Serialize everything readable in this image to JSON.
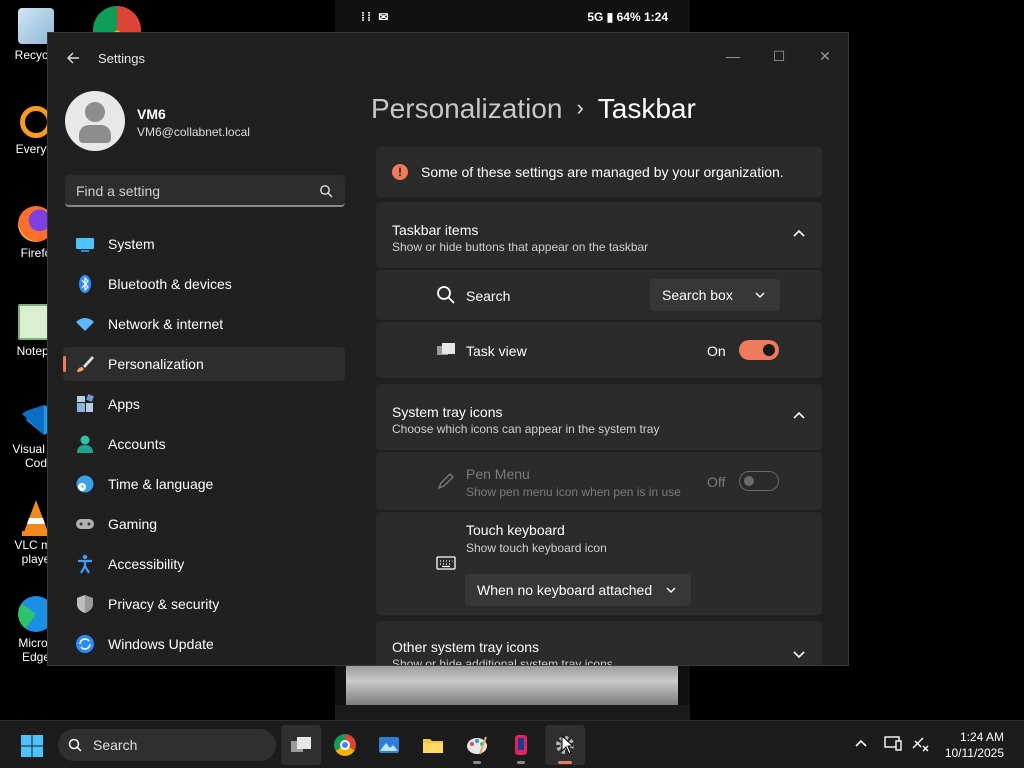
{
  "desktop": {
    "icons": [
      {
        "label": "Recycle",
        "icon": "recycle-bin-icon"
      },
      {
        "label": "Everyth",
        "icon": "everything-search-icon"
      },
      {
        "label": "Firefo",
        "icon": "firefox-icon"
      },
      {
        "label": "Notepa",
        "icon": "notepad-icon"
      },
      {
        "label": "Visual St",
        "label2": "Cod",
        "icon": "vscode-icon"
      },
      {
        "label": "VLC me",
        "label2": "playe",
        "icon": "vlc-icon"
      },
      {
        "label": "Micros",
        "label2": "Edge",
        "icon": "edge-icon"
      }
    ]
  },
  "phone": {
    "status_left": "⁞⁞ ✉",
    "status_right": "5G ▮ 64% 1:24"
  },
  "window": {
    "app_title": "Settings",
    "controls": {
      "minimize": "—",
      "maximize": "☐",
      "close": "✕"
    }
  },
  "profile": {
    "name": "VM6",
    "email": "VM6@collabnet.local"
  },
  "search": {
    "placeholder": "Find a setting"
  },
  "nav": {
    "items": [
      {
        "label": "System",
        "icon": "monitor-icon",
        "color": "#4cc2ff"
      },
      {
        "label": "Bluetooth & devices",
        "icon": "bluetooth-icon",
        "color": "#2c8bff"
      },
      {
        "label": "Network & internet",
        "icon": "wifi-icon",
        "color": "#5fb8ff"
      },
      {
        "label": "Personalization",
        "icon": "paintbrush-icon",
        "color": "#f0a35e",
        "active": true
      },
      {
        "label": "Apps",
        "icon": "apps-icon",
        "color": "#8fb3d9"
      },
      {
        "label": "Accounts",
        "icon": "person-icon",
        "color": "#2ec4a8"
      },
      {
        "label": "Time & language",
        "icon": "globe-clock-icon",
        "color": "#3aa0e8"
      },
      {
        "label": "Gaming",
        "icon": "gamepad-icon",
        "color": "#b0b0b0"
      },
      {
        "label": "Accessibility",
        "icon": "accessibility-icon",
        "color": "#3ba3ff"
      },
      {
        "label": "Privacy & security",
        "icon": "shield-icon",
        "color": "#9a9a9a"
      },
      {
        "label": "Windows Update",
        "icon": "update-icon",
        "color": "#2c8bff"
      }
    ]
  },
  "breadcrumb": {
    "parent": "Personalization",
    "separator": "›",
    "current": "Taskbar"
  },
  "banner": {
    "icon": "!",
    "text": "Some of these settings are managed by your organization."
  },
  "taskbar_items": {
    "title": "Taskbar items",
    "subtitle": "Show or hide buttons that appear on the taskbar",
    "search": {
      "label": "Search",
      "value": "Search box"
    },
    "task_view": {
      "label": "Task view",
      "state": "On"
    }
  },
  "system_tray": {
    "title": "System tray icons",
    "subtitle": "Choose which icons can appear in the system tray",
    "pen_menu": {
      "label": "Pen Menu",
      "desc": "Show pen menu icon when pen is in use",
      "state": "Off"
    },
    "touch_keyboard": {
      "label": "Touch keyboard",
      "desc": "Show touch keyboard icon",
      "value": "When no keyboard attached"
    }
  },
  "other_tray": {
    "title": "Other system tray icons",
    "subtitle": "Show or hide additional system tray icons"
  },
  "taskbar": {
    "search_label": "Search",
    "time": "1:24 AM",
    "date": "10/11/2025"
  },
  "colors": {
    "accent": "#f07a5e",
    "window_bg": "#202020",
    "card_bg": "#2b2b2b"
  }
}
